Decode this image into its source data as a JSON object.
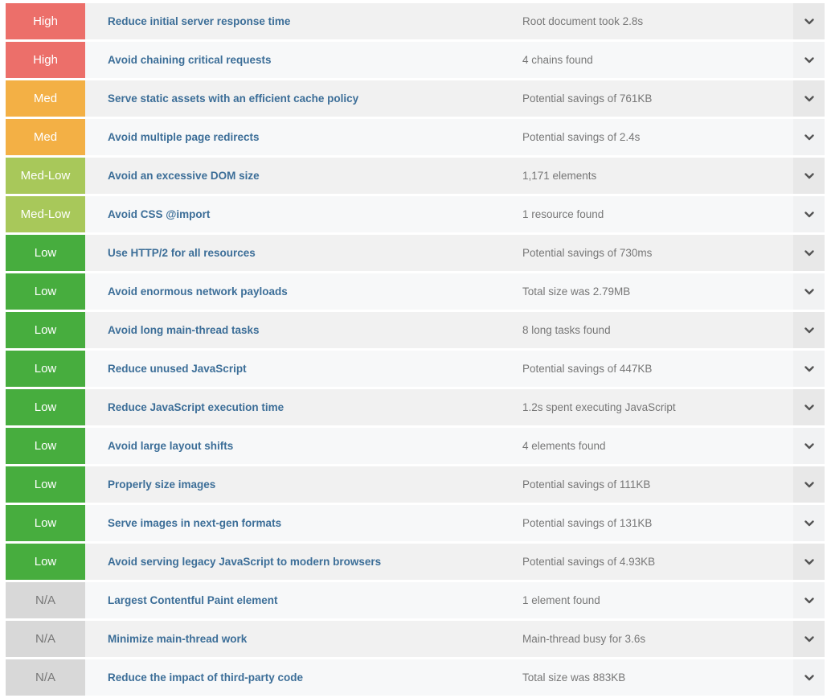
{
  "colors": {
    "high": "#ec6f6a",
    "med": "#f3b045",
    "medlow": "#a8c85a",
    "low": "#47ad3e",
    "na": "#d8d8d8",
    "title": "#3c6e98"
  },
  "rows": [
    {
      "priority": "High",
      "cls": "high",
      "title": "Reduce initial server response time",
      "detail": "Root document took 2.8s"
    },
    {
      "priority": "High",
      "cls": "high",
      "title": "Avoid chaining critical requests",
      "detail": "4 chains found"
    },
    {
      "priority": "Med",
      "cls": "med",
      "title": "Serve static assets with an efficient cache policy",
      "detail": "Potential savings of 761KB"
    },
    {
      "priority": "Med",
      "cls": "med",
      "title": "Avoid multiple page redirects",
      "detail": "Potential savings of 2.4s"
    },
    {
      "priority": "Med-Low",
      "cls": "medlow",
      "title": "Avoid an excessive DOM size",
      "detail": "1,171 elements"
    },
    {
      "priority": "Med-Low",
      "cls": "medlow",
      "title": "Avoid CSS @import",
      "detail": "1 resource found"
    },
    {
      "priority": "Low",
      "cls": "low",
      "title": "Use HTTP/2 for all resources",
      "detail": "Potential savings of 730ms"
    },
    {
      "priority": "Low",
      "cls": "low",
      "title": "Avoid enormous network payloads",
      "detail": "Total size was 2.79MB"
    },
    {
      "priority": "Low",
      "cls": "low",
      "title": "Avoid long main-thread tasks",
      "detail": "8 long tasks found"
    },
    {
      "priority": "Low",
      "cls": "low",
      "title": "Reduce unused JavaScript",
      "detail": "Potential savings of 447KB"
    },
    {
      "priority": "Low",
      "cls": "low",
      "title": "Reduce JavaScript execution time",
      "detail": "1.2s spent executing JavaScript"
    },
    {
      "priority": "Low",
      "cls": "low",
      "title": "Avoid large layout shifts",
      "detail": "4 elements found"
    },
    {
      "priority": "Low",
      "cls": "low",
      "title": "Properly size images",
      "detail": "Potential savings of 111KB"
    },
    {
      "priority": "Low",
      "cls": "low",
      "title": "Serve images in next-gen formats",
      "detail": "Potential savings of 131KB"
    },
    {
      "priority": "Low",
      "cls": "low",
      "title": "Avoid serving legacy JavaScript to modern browsers",
      "detail": "Potential savings of 4.93KB"
    },
    {
      "priority": "N/A",
      "cls": "na",
      "title": "Largest Contentful Paint element",
      "detail": "1 element found"
    },
    {
      "priority": "N/A",
      "cls": "na",
      "title": "Minimize main-thread work",
      "detail": "Main-thread busy for 3.6s"
    },
    {
      "priority": "N/A",
      "cls": "na",
      "title": "Reduce the impact of third-party code",
      "detail": "Total size was 883KB"
    }
  ],
  "icons": {
    "expand": "chevron-down-icon"
  }
}
